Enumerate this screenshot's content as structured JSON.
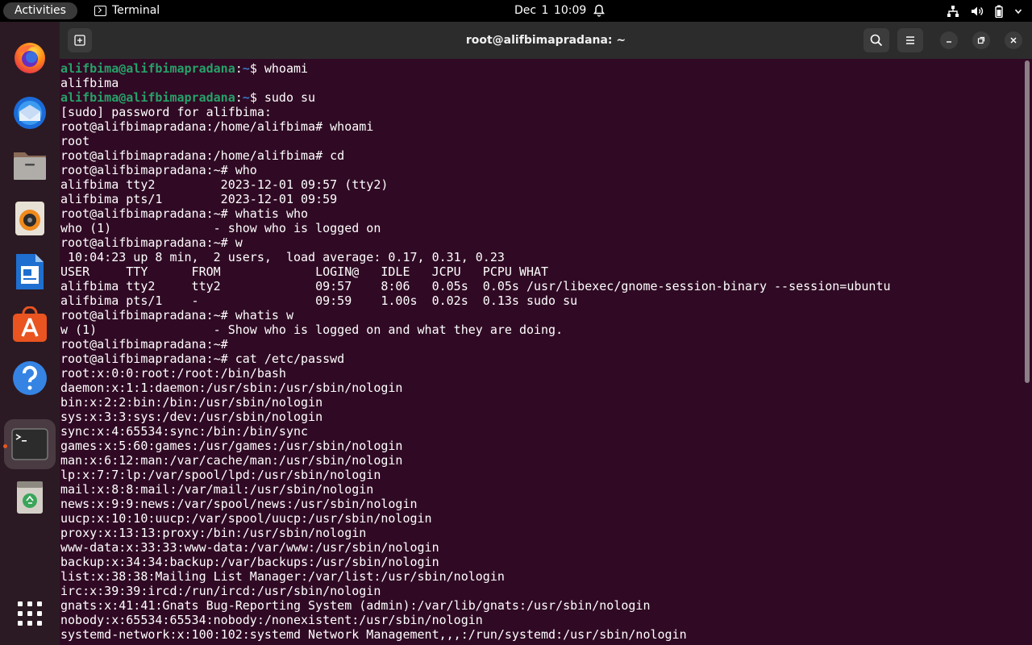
{
  "topbar": {
    "activities": "Activities",
    "app_name": "Terminal",
    "date": "Dec 1",
    "time": "10:09"
  },
  "dock": {
    "items": [
      "firefox",
      "thunderbird",
      "files",
      "rhythmbox",
      "libreoffice-writer",
      "app-center",
      "help",
      "terminal",
      "trash",
      "show-apps"
    ]
  },
  "window": {
    "title": "root@alifbimapradana: ~"
  },
  "terminal": {
    "colors": {
      "background": "#300a24",
      "user": "#26a269",
      "path": "#3a77c6",
      "text": "#ffffff"
    },
    "lines": [
      {
        "user": "alifbima@alifbimapradana",
        "path": "~",
        "cmd": "$ whoami"
      },
      {
        "text": "alifbima"
      },
      {
        "user": "alifbima@alifbimapradana",
        "path": "~",
        "cmd": "$ sudo su"
      },
      {
        "text": "[sudo] password for alifbima:"
      },
      {
        "text": "root@alifbimapradana:/home/alifbima# whoami"
      },
      {
        "text": "root"
      },
      {
        "text": "root@alifbimapradana:/home/alifbima# cd"
      },
      {
        "text": "root@alifbimapradana:~# who"
      },
      {
        "text": "alifbima tty2         2023-12-01 09:57 (tty2)"
      },
      {
        "text": "alifbima pts/1        2023-12-01 09:59"
      },
      {
        "text": "root@alifbimapradana:~# whatis who"
      },
      {
        "text": "who (1)              - show who is logged on"
      },
      {
        "text": "root@alifbimapradana:~# w"
      },
      {
        "text": " 10:04:23 up 8 min,  2 users,  load average: 0.17, 0.31, 0.23"
      },
      {
        "text": "USER     TTY      FROM             LOGIN@   IDLE   JCPU   PCPU WHAT"
      },
      {
        "text": "alifbima tty2     tty2             09:57    8:06   0.05s  0.05s /usr/libexec/gnome-session-binary --session=ubuntu"
      },
      {
        "text": "alifbima pts/1    -                09:59    1.00s  0.02s  0.13s sudo su"
      },
      {
        "text": "root@alifbimapradana:~# whatis w"
      },
      {
        "text": "w (1)                - Show who is logged on and what they are doing."
      },
      {
        "text": "root@alifbimapradana:~#"
      },
      {
        "text": "root@alifbimapradana:~# cat /etc/passwd"
      },
      {
        "text": "root:x:0:0:root:/root:/bin/bash"
      },
      {
        "text": "daemon:x:1:1:daemon:/usr/sbin:/usr/sbin/nologin"
      },
      {
        "text": "bin:x:2:2:bin:/bin:/usr/sbin/nologin"
      },
      {
        "text": "sys:x:3:3:sys:/dev:/usr/sbin/nologin"
      },
      {
        "text": "sync:x:4:65534:sync:/bin:/bin/sync"
      },
      {
        "text": "games:x:5:60:games:/usr/games:/usr/sbin/nologin"
      },
      {
        "text": "man:x:6:12:man:/var/cache/man:/usr/sbin/nologin"
      },
      {
        "text": "lp:x:7:7:lp:/var/spool/lpd:/usr/sbin/nologin"
      },
      {
        "text": "mail:x:8:8:mail:/var/mail:/usr/sbin/nologin"
      },
      {
        "text": "news:x:9:9:news:/var/spool/news:/usr/sbin/nologin"
      },
      {
        "text": "uucp:x:10:10:uucp:/var/spool/uucp:/usr/sbin/nologin"
      },
      {
        "text": "proxy:x:13:13:proxy:/bin:/usr/sbin/nologin"
      },
      {
        "text": "www-data:x:33:33:www-data:/var/www:/usr/sbin/nologin"
      },
      {
        "text": "backup:x:34:34:backup:/var/backups:/usr/sbin/nologin"
      },
      {
        "text": "list:x:38:38:Mailing List Manager:/var/list:/usr/sbin/nologin"
      },
      {
        "text": "irc:x:39:39:ircd:/run/ircd:/usr/sbin/nologin"
      },
      {
        "text": "gnats:x:41:41:Gnats Bug-Reporting System (admin):/var/lib/gnats:/usr/sbin/nologin"
      },
      {
        "text": "nobody:x:65534:65534:nobody:/nonexistent:/usr/sbin/nologin"
      },
      {
        "text": "systemd-network:x:100:102:systemd Network Management,,,:/run/systemd:/usr/sbin/nologin"
      }
    ]
  }
}
